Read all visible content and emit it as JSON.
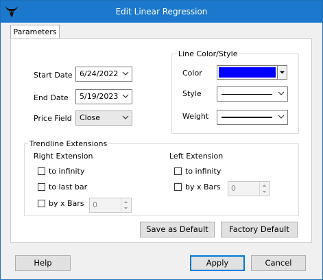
{
  "window": {
    "title": "Edit Linear Regression",
    "titlebar_color": "#1b78cc"
  },
  "tabs": [
    {
      "label": "Parameters",
      "selected": true
    }
  ],
  "params": {
    "start_date_label": "Start Date",
    "start_date_value": "6/24/2022",
    "end_date_label": "End Date",
    "end_date_value": "5/19/2023",
    "price_field_label": "Price Field",
    "price_field_value": "Close"
  },
  "line_style": {
    "group_label": "Line Color/Style",
    "color_label": "Color",
    "color_value": "#0000ff",
    "style_label": "Style",
    "weight_label": "Weight"
  },
  "extensions": {
    "group_label": "Trendline Extensions",
    "right": {
      "heading": "Right Extension",
      "to_infinity_label": "to infinity",
      "to_infinity_checked": false,
      "to_last_bar_label": "to last bar",
      "to_last_bar_checked": false,
      "by_x_bars_label": "by x Bars",
      "by_x_bars_checked": false,
      "by_x_bars_value": "0"
    },
    "left": {
      "heading": "Left Extension",
      "to_infinity_label": "to infinity",
      "to_infinity_checked": false,
      "by_x_bars_label": "by x Bars",
      "by_x_bars_checked": false,
      "by_x_bars_value": "0"
    }
  },
  "panel_buttons": {
    "save_default": "Save as Default",
    "factory_default": "Factory Default"
  },
  "footer": {
    "help": "Help",
    "apply": "Apply",
    "cancel": "Cancel"
  },
  "icons": {
    "app_logo": "bull-logo-icon",
    "dropdown": "chevron-down-icon",
    "spin_up": "spin-up-icon",
    "spin_down": "spin-down-icon"
  }
}
